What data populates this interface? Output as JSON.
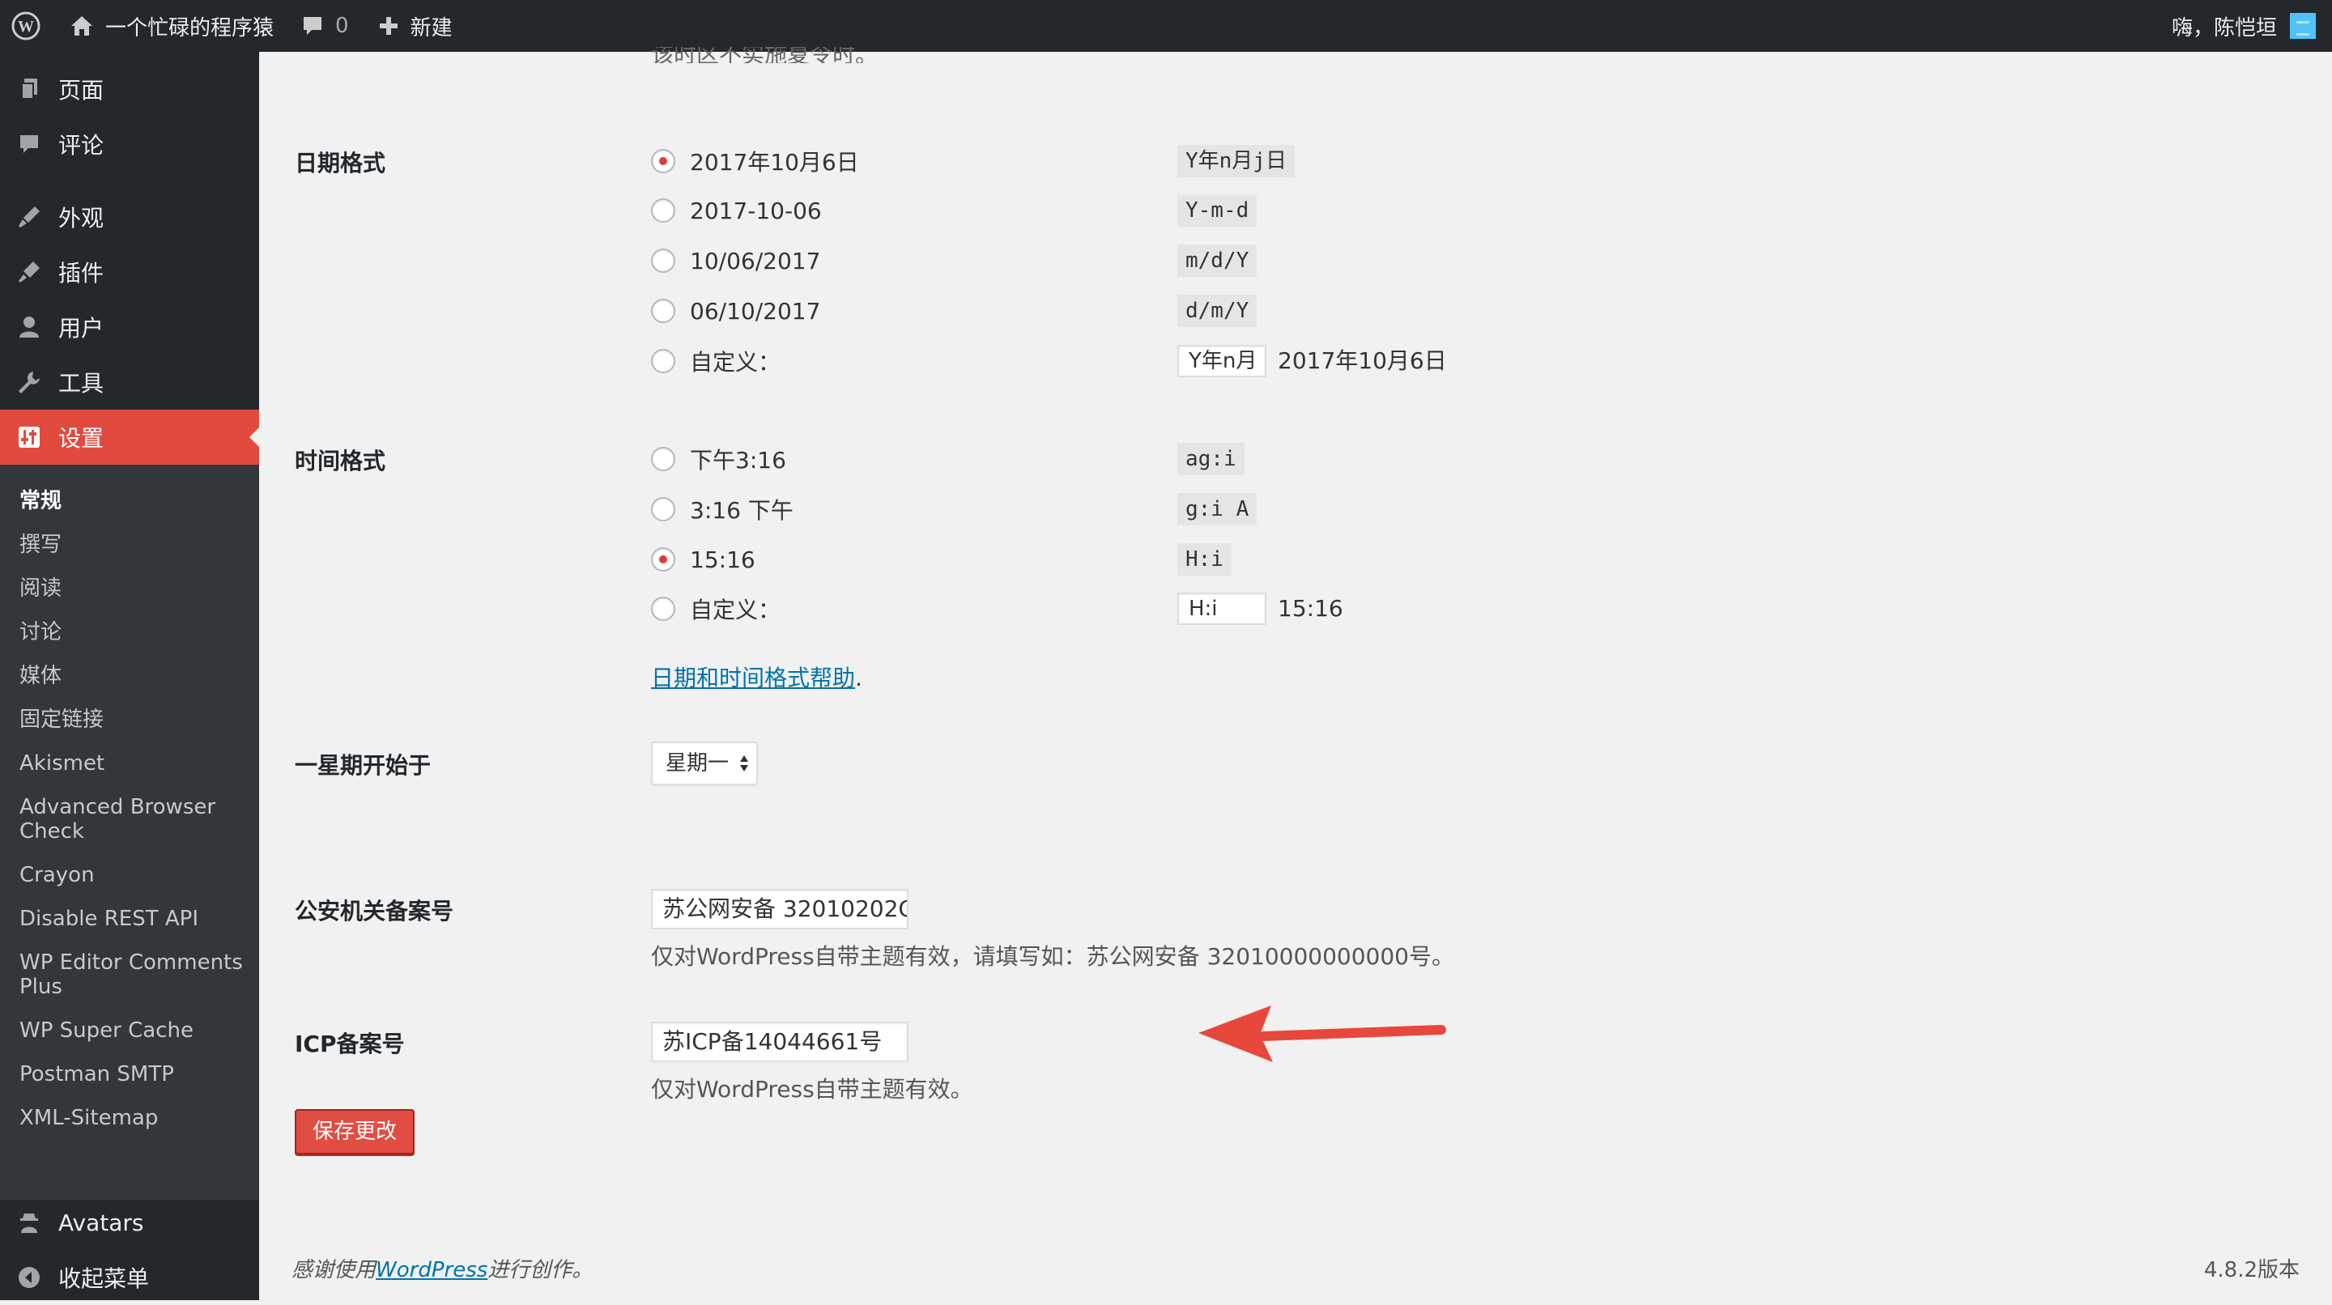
{
  "adminbar": {
    "site_name": "一个忙碌的程序猿",
    "comments_count": "0",
    "new_label": "新建",
    "greeting": "嗨，陈恺垣"
  },
  "sidebar": {
    "menu": [
      {
        "label": "页面",
        "icon": "pages-icon"
      },
      {
        "label": "评论",
        "icon": "comments-icon"
      },
      {
        "label": "外观",
        "icon": "appearance-icon"
      },
      {
        "label": "插件",
        "icon": "plugins-icon"
      },
      {
        "label": "用户",
        "icon": "users-icon"
      },
      {
        "label": "工具",
        "icon": "tools-icon"
      },
      {
        "label": "设置",
        "icon": "settings-icon"
      }
    ],
    "submenu": [
      "常规",
      "撰写",
      "阅读",
      "讨论",
      "媒体",
      "固定链接",
      "Akismet",
      "Advanced Browser Check",
      "Crayon",
      "Disable REST API",
      "WP Editor Comments Plus",
      "WP Super Cache",
      "Postman SMTP",
      "XML-Sitemap"
    ],
    "bottom": [
      {
        "label": "Avatars",
        "icon": "avatars-icon"
      },
      {
        "label": "收起菜单",
        "icon": "collapse-icon"
      }
    ]
  },
  "content": {
    "cut_text": "该时区不实施夏令时。",
    "date_format": {
      "label": "日期格式",
      "options": [
        {
          "text": "2017年10月6日",
          "code": "Y年n月j日",
          "checked": true
        },
        {
          "text": "2017-10-06",
          "code": "Y-m-d",
          "checked": false
        },
        {
          "text": "10/06/2017",
          "code": "m/d/Y",
          "checked": false
        },
        {
          "text": "06/10/2017",
          "code": "d/m/Y",
          "checked": false
        }
      ],
      "custom_label": "自定义：",
      "custom_value": "Y年n月",
      "custom_preview": "2017年10月6日"
    },
    "time_format": {
      "label": "时间格式",
      "options": [
        {
          "text": "下午3:16",
          "code": "ag:i",
          "checked": false
        },
        {
          "text": "3:16 下午",
          "code": "g:i A",
          "checked": false
        },
        {
          "text": "15:16",
          "code": "H:i",
          "checked": true
        }
      ],
      "custom_label": "自定义：",
      "custom_value": "H:i",
      "custom_preview": "15:16"
    },
    "help_link": "日期和时间格式帮助",
    "help_suffix": ".",
    "week_start": {
      "label": "一星期开始于",
      "value": "星期一"
    },
    "police": {
      "label": "公安机关备案号",
      "value": "苏公网安备 32010202C",
      "desc": "仅对WordPress自带主题有效，请填写如：苏公网安备 32010000000000号。"
    },
    "icp": {
      "label": "ICP备案号",
      "value": "苏ICP备14044661号",
      "desc": "仅对WordPress自带主题有效。"
    },
    "save_label": "保存更改"
  },
  "footer": {
    "thanks_prefix": "感谢使用",
    "thanks_link": "WordPress",
    "thanks_suffix": "进行创作。",
    "version": "4.8.2版本"
  },
  "colors": {
    "accent": "#e14d43",
    "link": "#0073aa",
    "sidebar_bg": "#23282d",
    "annotation": "#e8473c"
  }
}
